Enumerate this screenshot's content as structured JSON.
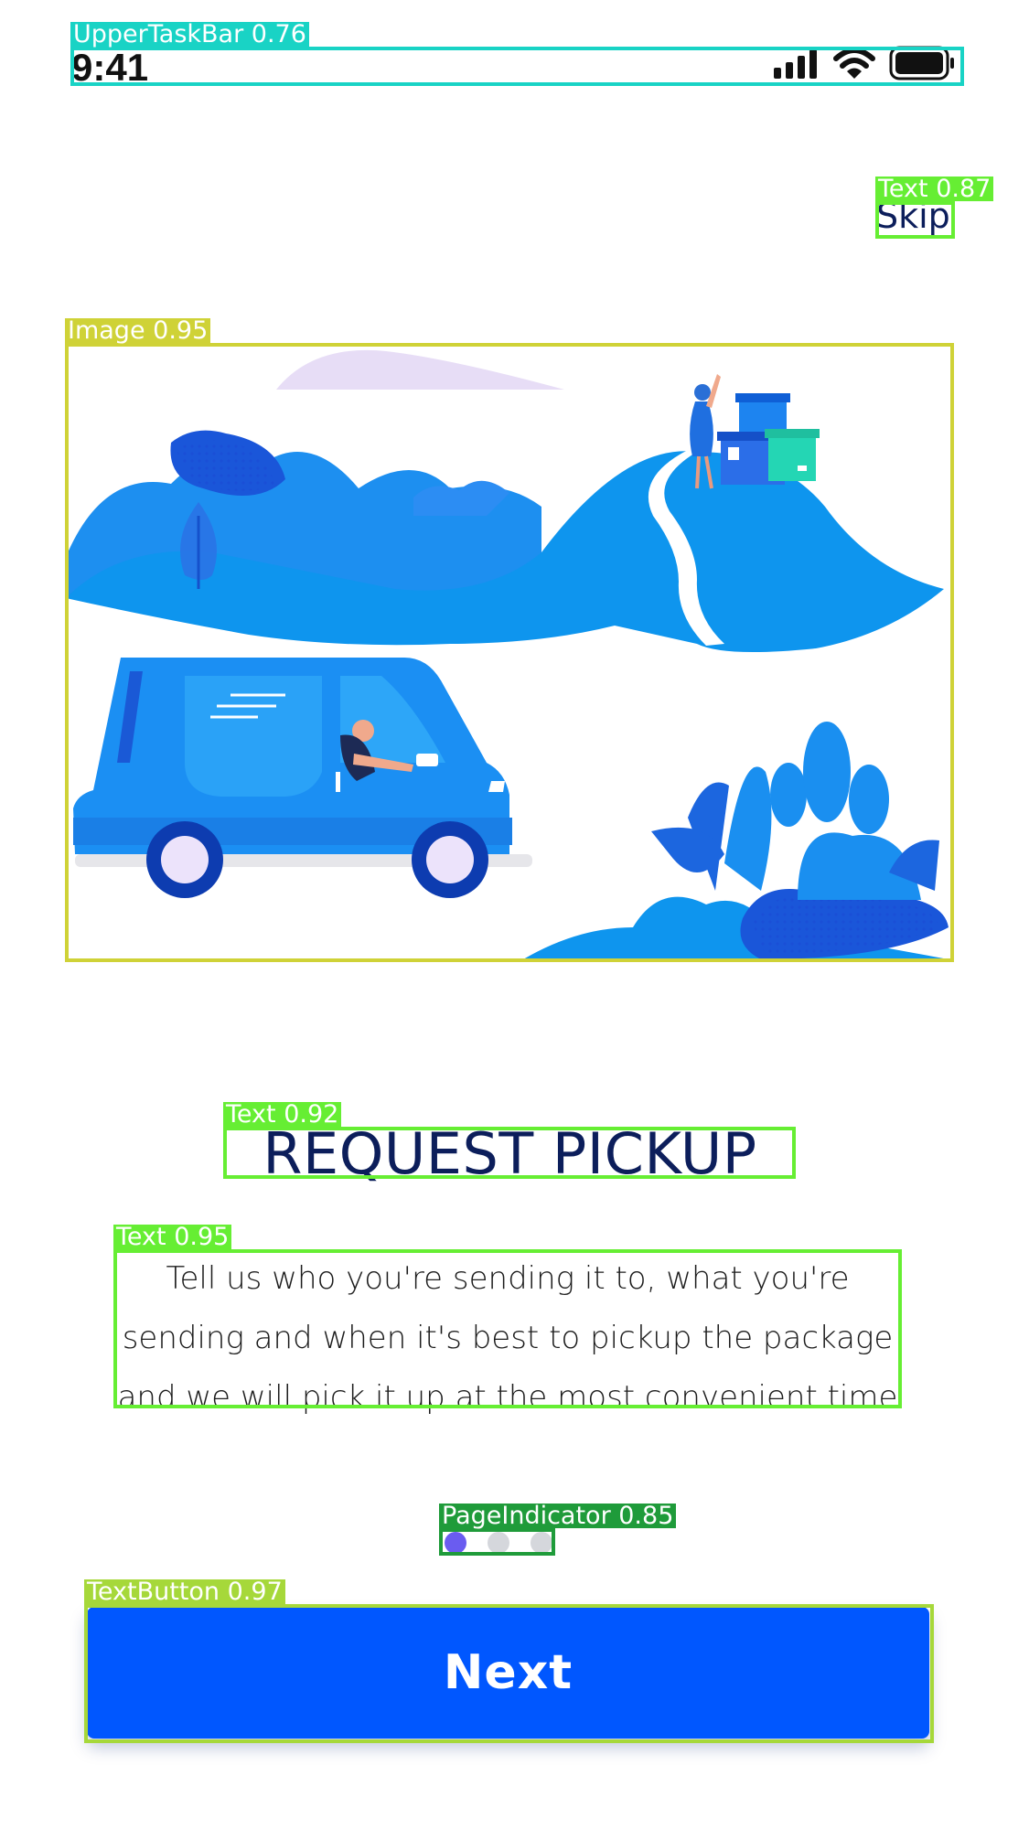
{
  "status_bar": {
    "time": "9:41",
    "icons": [
      "signal-icon",
      "wifi-icon",
      "battery-icon"
    ]
  },
  "onboarding": {
    "skip_label": "Skip",
    "illustration": "delivery-van-illustration",
    "title": "REQUEST PICKUP",
    "description": "Tell us who you're sending it to, what you're sending and when it's best to pickup the package and we will pick it up at the most convenient time",
    "page_indicator": {
      "current": 1,
      "total": 3
    },
    "next_label": "Next"
  },
  "colors": {
    "primary": "#0057ff",
    "title": "#0c1e5b",
    "dot_active": "#6a5cf0",
    "dot_inactive": "#d5d7dc"
  },
  "detections": [
    {
      "label": "UpperTaskBar 0.76",
      "color": "#19d3c5"
    },
    {
      "label": "Text 0.87",
      "color": "#66ee33"
    },
    {
      "label": "Image 0.95",
      "color": "#cfd237"
    },
    {
      "label": "Text 0.92",
      "color": "#66ee33"
    },
    {
      "label": "Text 0.95",
      "color": "#66ee33"
    },
    {
      "label": "PageIndicator 0.85",
      "color": "#1f9b3a"
    },
    {
      "label": "TextButton 0.97",
      "color": "#a6d83a"
    }
  ]
}
